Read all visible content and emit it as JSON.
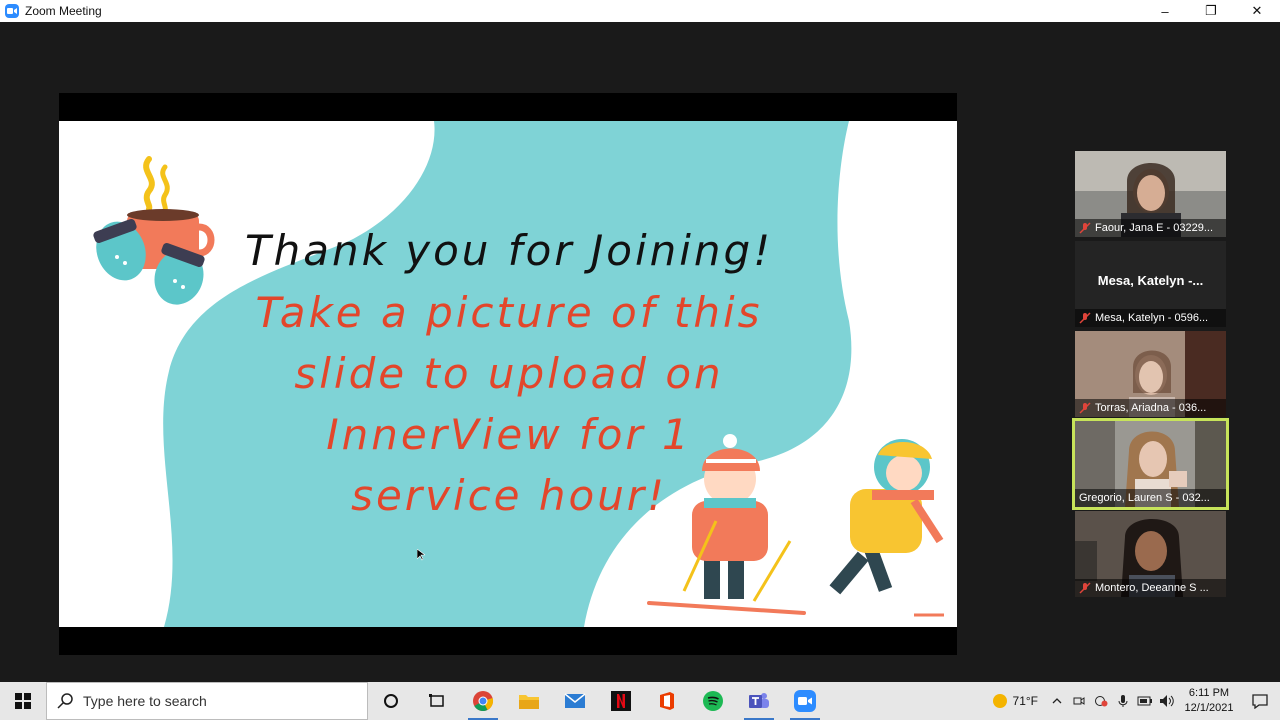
{
  "window": {
    "title": "Zoom Meeting",
    "minimize": "–",
    "restore": "❐",
    "close": "✕"
  },
  "slide": {
    "line1": "Thank you for Joining!",
    "line2": "Take a picture of this",
    "line3": "slide to upload on",
    "line4": "InnerView for 1",
    "line5": "service hour!"
  },
  "participants": [
    {
      "label": "Faour, Jana E - 03229...",
      "video": true
    },
    {
      "display": "Mesa,  Katelyn -...",
      "label": "Mesa, Katelyn - 0596...",
      "video": false
    },
    {
      "label": "Torras, Ariadna - 036...",
      "video": true
    },
    {
      "label": "Gregorio, Lauren S - 032...",
      "video": true,
      "active": true
    },
    {
      "label": "Montero, Deeanne S ...",
      "video": true
    }
  ],
  "taskbar": {
    "search_placeholder": "Type here to search",
    "apps": [
      "cortana-icon",
      "task-view-icon",
      "chrome-icon",
      "file-explorer-icon",
      "mail-icon",
      "netflix-icon",
      "office-icon",
      "spotify-icon",
      "teams-icon",
      "zoom-icon"
    ],
    "weather": "71°F",
    "time": "6:11 PM",
    "date": "12/1/2021"
  },
  "colors": {
    "teal": "#7fd3d6",
    "slide_red": "#e3462b",
    "zoom_blue": "#2d8cff",
    "active_speaker": "#c7e35a"
  }
}
